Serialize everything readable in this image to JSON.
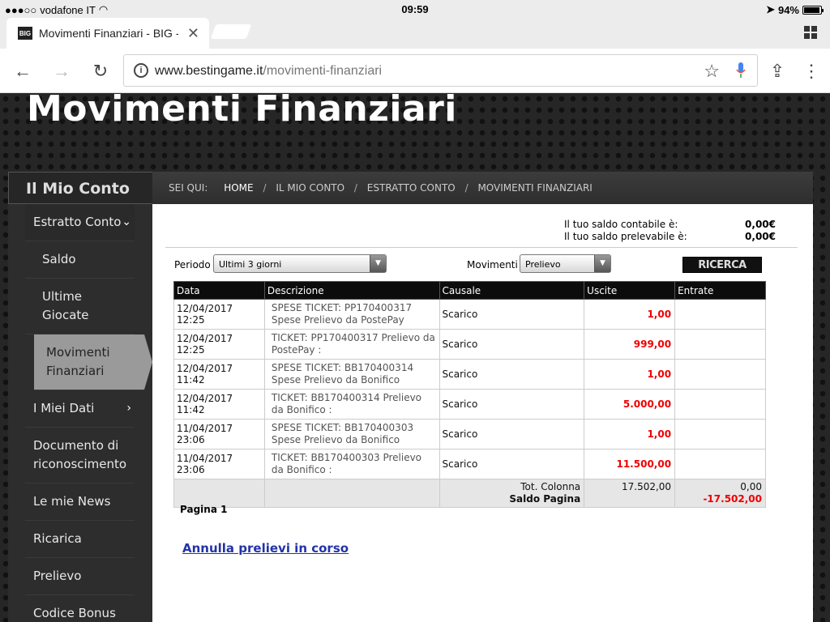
{
  "status": {
    "carrier": "vodafone IT",
    "time": "09:59",
    "battery": "94%",
    "battery_level": 0.94
  },
  "tab": {
    "favicon": "BIG",
    "title": "Movimenti Finanziari - BIG -",
    "close": "✕"
  },
  "url": {
    "host": "www.bestingame.it",
    "path": "/movimenti-finanziari"
  },
  "page": {
    "title": "Movimenti Finanziari"
  },
  "sidebar": {
    "title": "Il Mio Conto",
    "items": [
      {
        "label": "Estratto Conto",
        "chevron": "⌄"
      },
      {
        "label": "Saldo"
      },
      {
        "label": "Ultime Giocate"
      },
      {
        "label": "Movimenti Finanziari"
      },
      {
        "label": "I Miei Dati",
        "chevron": "›"
      },
      {
        "label": "Documento di riconoscimento"
      },
      {
        "label": "Le mie News"
      },
      {
        "label": "Ricarica"
      },
      {
        "label": "Prelievo"
      },
      {
        "label": "Codice Bonus"
      }
    ]
  },
  "breadcrumb": {
    "prefix": "SEI QUI:",
    "items": [
      "HOME",
      "IL MIO CONTO",
      "ESTRATTO CONTO",
      "MOVIMENTI FINANZIARI"
    ],
    "sep": "/"
  },
  "saldo": {
    "contabile_label": "Il tuo saldo contabile è:",
    "contabile_value": "0,00€",
    "prelevabile_label": "Il tuo saldo prelevabile è:",
    "prelevabile_value": "0,00€"
  },
  "filters": {
    "periodo_label": "Periodo",
    "periodo_value": "Ultimi 3 giorni",
    "movimenti_label": "Movimenti",
    "movimenti_value": "Prelievo",
    "search_label": "RICERCA"
  },
  "table": {
    "headers": [
      "Data",
      "Descrizione",
      "Causale",
      "Uscite",
      "Entrate"
    ],
    "rows": [
      {
        "date": "12/04/2017",
        "time": "12:25",
        "desc1": "SPESE TICKET: PP170400317",
        "desc2": "Spese Prelievo da PostePay",
        "causale": "Scarico",
        "uscite": "1,00",
        "entrate": ""
      },
      {
        "date": "12/04/2017",
        "time": "12:25",
        "desc1": "TICKET: PP170400317 Prelievo da",
        "desc2": "PostePay :",
        "causale": "Scarico",
        "uscite": "999,00",
        "entrate": ""
      },
      {
        "date": "12/04/2017",
        "time": "11:42",
        "desc1": "SPESE TICKET: BB170400314",
        "desc2": "Spese Prelievo da Bonifico",
        "causale": "Scarico",
        "uscite": "1,00",
        "entrate": ""
      },
      {
        "date": "12/04/2017",
        "time": "11:42",
        "desc1": "TICKET: BB170400314 Prelievo",
        "desc2": "da Bonifico :",
        "causale": "Scarico",
        "uscite": "5.000,00",
        "entrate": ""
      },
      {
        "date": "11/04/2017",
        "time": "23:06",
        "desc1": "SPESE TICKET: BB170400303",
        "desc2": "Spese Prelievo da Bonifico",
        "causale": "Scarico",
        "uscite": "1,00",
        "entrate": ""
      },
      {
        "date": "11/04/2017",
        "time": "23:06",
        "desc1": "TICKET: BB170400303 Prelievo",
        "desc2": "da Bonifico :",
        "causale": "Scarico",
        "uscite": "11.500,00",
        "entrate": ""
      }
    ],
    "totals": {
      "tot_label": "Tot. Colonna",
      "saldo_label": "Saldo Pagina",
      "uscite": "17.502,00",
      "entrate": "0,00",
      "saldo": "-17.502,00"
    }
  },
  "pagination": "Pagina 1",
  "annulla": "Annulla prelievi in corso"
}
